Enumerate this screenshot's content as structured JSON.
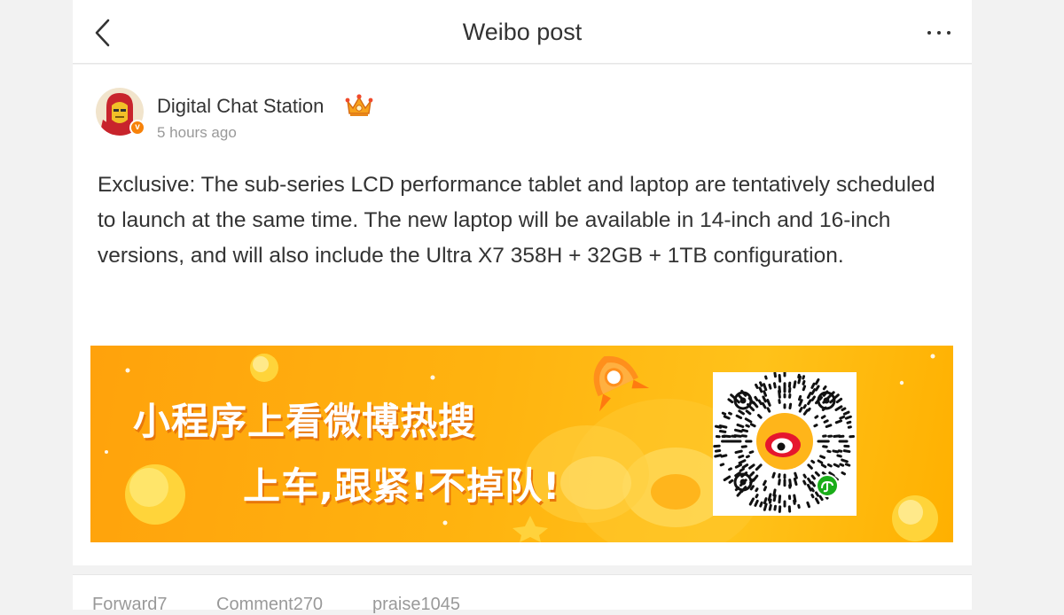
{
  "header": {
    "title": "Weibo post"
  },
  "post": {
    "author": "Digital Chat Station",
    "time": "5 hours ago",
    "text": "Exclusive: The sub-series LCD performance tablet and laptop are tentatively scheduled to launch at the same time. The new laptop will be available in 14-inch and 16-inch versions, and will also include the Ultra X7 358H + 32GB + 1TB configuration.",
    "verified_mark": "v"
  },
  "banner": {
    "line1": "小程序上看微博热搜",
    "line2": "上车,跟紧!不掉队!"
  },
  "stats": {
    "forward": "Forward7",
    "comment": "Comment270",
    "like": "praise1045"
  },
  "colors": {
    "accent": "#f7820a",
    "banner": "#ffb30f",
    "text": "#333333",
    "muted": "#999999"
  }
}
